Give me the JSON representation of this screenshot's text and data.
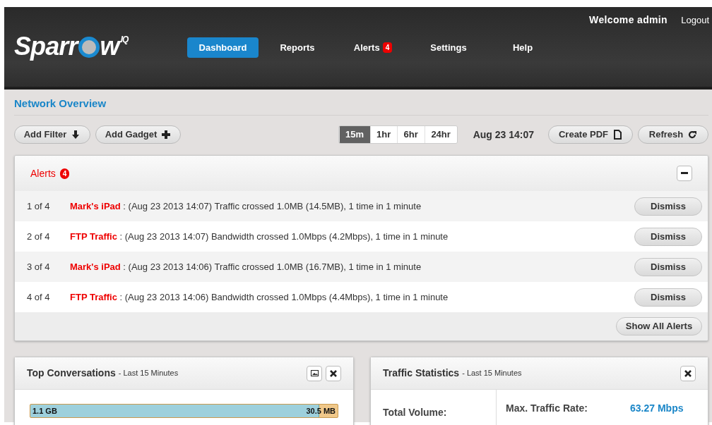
{
  "header": {
    "logo": {
      "before": "Sparr",
      "after": "w",
      "superscript": "IQ"
    },
    "welcome": "Welcome admin",
    "logout": "Logout",
    "nav": [
      {
        "label": "Dashboard",
        "selected": true
      },
      {
        "label": "Reports",
        "selected": false
      },
      {
        "label": "Alerts",
        "selected": false,
        "badge": "4"
      },
      {
        "label": "Settings",
        "selected": false
      },
      {
        "label": "Help",
        "selected": false
      }
    ]
  },
  "page_title": "Network Overview",
  "toolbar": {
    "left_buttons": [
      {
        "label": "Add Filter"
      },
      {
        "label": "Add Gadget"
      }
    ],
    "ranges": [
      {
        "label": "15m",
        "selected": true
      },
      {
        "label": "1hr",
        "selected": false
      },
      {
        "label": "6hr",
        "selected": false
      },
      {
        "label": "24hr",
        "selected": false
      }
    ],
    "timestamp": "Aug 23 14:07",
    "right_buttons": [
      {
        "label": "Create PDF"
      },
      {
        "label": "Refresh"
      }
    ]
  },
  "alerts_panel": {
    "title": "Alerts",
    "badge": "4",
    "rows": [
      {
        "index": "1 of 4",
        "source": "Mark's iPad",
        "message": ": (Aug 23 2013 14:07) Traffic crossed 1.0MB (14.5MB), 1 time in 1 minute",
        "button": "Dismiss"
      },
      {
        "index": "2 of 4",
        "source": "FTP Traffic",
        "message": ": (Aug 23 2013 14:07) Bandwidth crossed 1.0Mbps (4.2Mbps), 1 time in 1 minute",
        "button": "Dismiss"
      },
      {
        "index": "3 of 4",
        "source": "Mark's iPad",
        "message": ": (Aug 23 2013 14:06) Traffic crossed 1.0MB (16.7MB), 1 time in 1 minute",
        "button": "Dismiss"
      },
      {
        "index": "4 of 4",
        "source": "FTP Traffic",
        "message": ": (Aug 23 2013 14:06) Bandwidth crossed 1.0Mbps (4.4Mbps), 1 time in 1 minute",
        "button": "Dismiss"
      }
    ],
    "footer_button": "Show All Alerts"
  },
  "top_conversations": {
    "title": "Top Conversations",
    "subtitle": "- Last 15 Minutes",
    "bar": {
      "level": 0.94,
      "left_label": "1.1 GB",
      "right_label": "30.5 MB"
    }
  },
  "traffic_statistics": {
    "title": "Traffic Statistics",
    "subtitle": "- Last 15 Minutes",
    "total_volume_label": "Total Volume:",
    "max_rate_label": "Max. Traffic Rate:",
    "max_rate_value": "63.27 Mbps"
  }
}
